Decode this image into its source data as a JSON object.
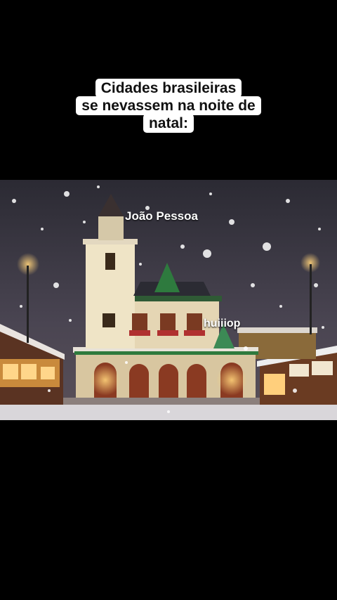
{
  "caption": {
    "line1": "Cidades brasileiras",
    "line2": "se nevassem na noite de",
    "line3": "natal:"
  },
  "overlay": {
    "city": "João Pessoa",
    "username": "huiiiop"
  }
}
